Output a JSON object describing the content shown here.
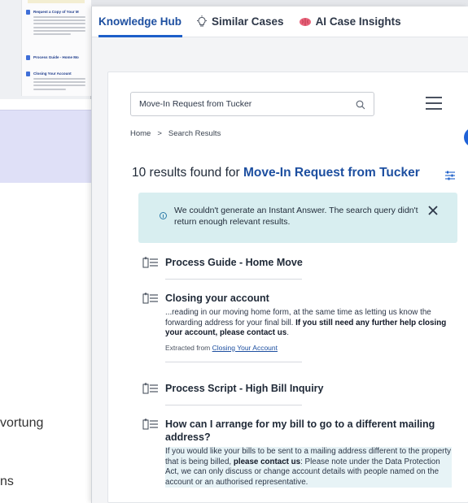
{
  "background": {
    "doc_items": [
      {
        "title": "Request a Copy of Your M"
      },
      {
        "title": "Process Guide - Home Mo"
      },
      {
        "title": "Closing Your Account"
      }
    ],
    "text_fragments": [
      "vortung",
      "ns"
    ]
  },
  "tabs": [
    {
      "label": "Knowledge Hub",
      "icon": "",
      "active": true
    },
    {
      "label": "Similar Cases",
      "icon": "lightbulb-icon",
      "active": false
    },
    {
      "label": "AI Case Insights",
      "icon": "brain-icon",
      "active": false
    }
  ],
  "search": {
    "value": "Move-In Request from Tucker",
    "placeholder": ""
  },
  "breadcrumb": {
    "home": "Home",
    "separator": ">",
    "current": "Search Results"
  },
  "results_header": {
    "prefix": "10 results found for",
    "query": "Move-In Request from Tucker"
  },
  "notice": {
    "text": "We couldn't generate an Instant Answer. The search query didn't return enough relevant results."
  },
  "results": [
    {
      "title": "Process Guide - Home Move"
    },
    {
      "title": "Closing your account",
      "snippet_pre": "...reading in our moving home form, at the same time as letting us know the forwarding address for your final bill. ",
      "snippet_bold": "If you still need any further help closing your account, please contact us",
      "snippet_post": ".",
      "extracted_label": "Extracted from",
      "extracted_link": "Closing Your Account"
    },
    {
      "title": "Process Script - High Bill Inquiry"
    },
    {
      "title": "How can I arrange for my bill to go to a different mailing address?",
      "snippet_pre": "If you would like your bills to be sent to a mailing address different to the property that is being billed, ",
      "snippet_bold": "please contact us",
      "snippet_post": ": Please note under the Data Protection Act, we can only discuss or change account details with people named on the account or an authorised representative."
    }
  ],
  "colors": {
    "accent": "#1d4fa0",
    "notice_bg": "#d8eef0",
    "dot": "#1f62d8"
  }
}
